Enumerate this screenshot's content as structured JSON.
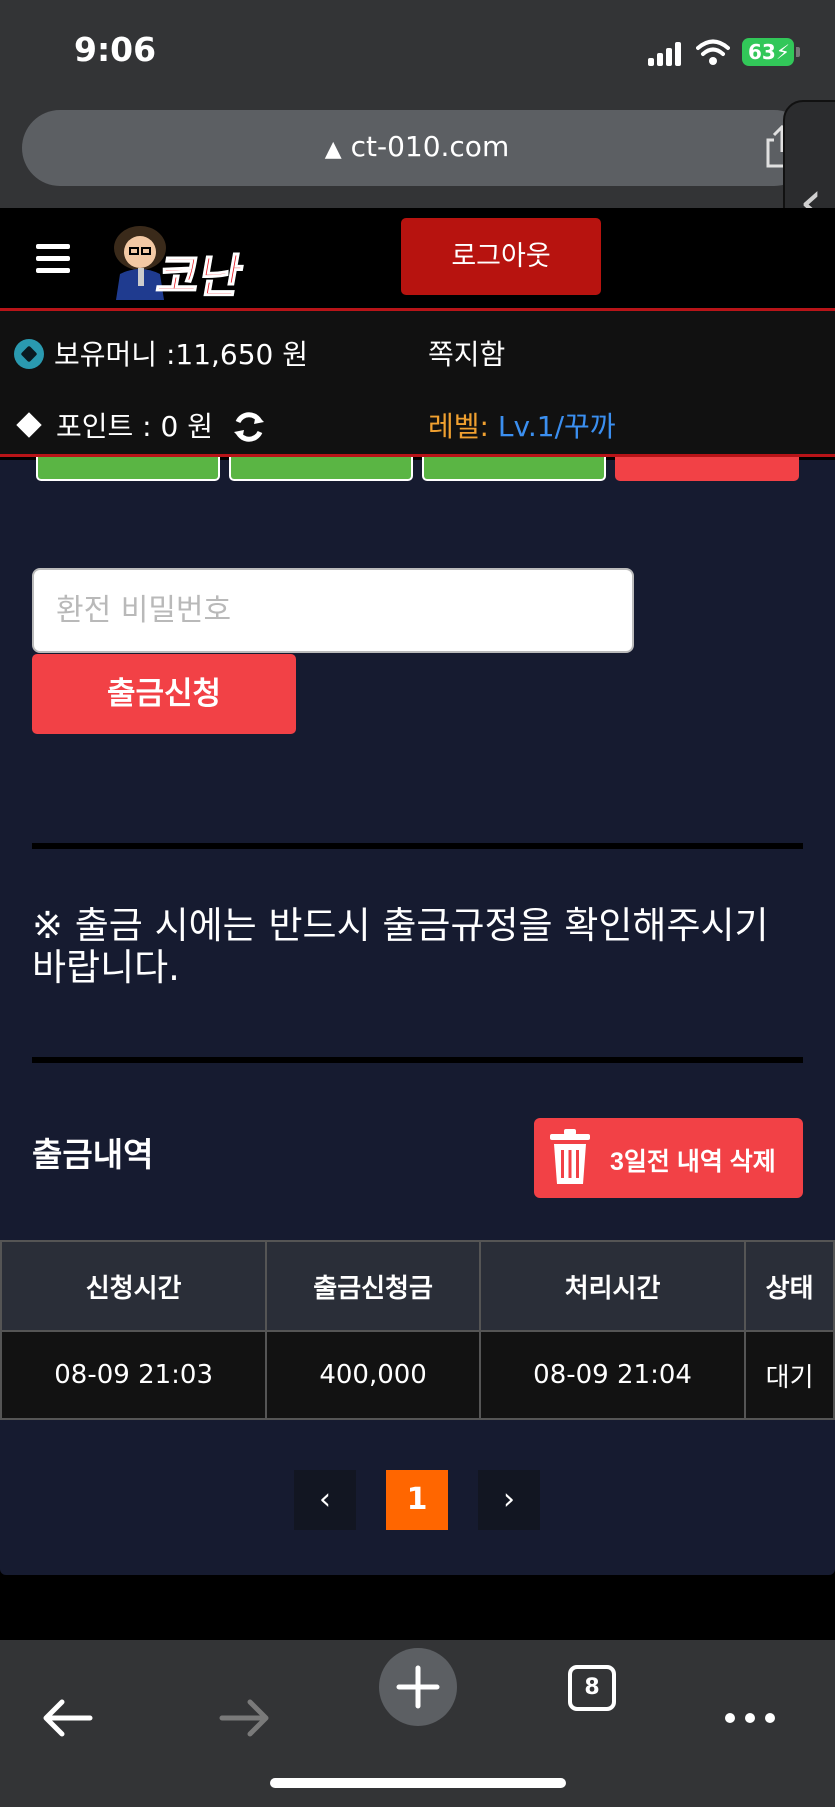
{
  "status_bar": {
    "time": "9:06",
    "battery": "63"
  },
  "browser": {
    "url": "ct-010.com",
    "tab_count": "8"
  },
  "header": {
    "logo_text": "코난",
    "logout_label": "로그아웃"
  },
  "info": {
    "money_label": "보유머니 :11,650 원",
    "memo_label": "쪽지함",
    "point_label": "포인트 :   0 원",
    "level_label": "레벨:",
    "level_value": "Lv.1/꾸까"
  },
  "form": {
    "password_placeholder": "환전 비밀번호",
    "submit_label": "출금신청"
  },
  "notice": "※ 출금 시에는 반드시 출금규정을 확인해주시기 바랍니다.",
  "history": {
    "title": "출금내역",
    "delete_label": "3일전 내역 삭제",
    "columns": [
      "신청시간",
      "출금신청금",
      "처리시간",
      "상태"
    ],
    "rows": [
      [
        "08-09 21:03",
        "400,000",
        "08-09 21:04",
        "대기"
      ]
    ]
  },
  "pagination": {
    "prev": "‹",
    "current": "1",
    "next": "›"
  },
  "colors": {
    "accent_red": "#f24146",
    "header_red": "#b7130f",
    "page_bg": "#161b30",
    "page_active": "#ff6600",
    "level_blue": "#3b8ff0",
    "level_orange": "#f0a030"
  }
}
